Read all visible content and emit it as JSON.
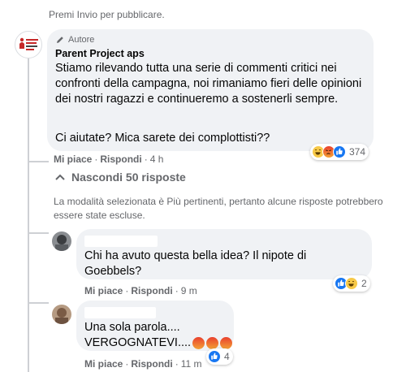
{
  "composer_hint": "Premi Invio per pubblicare.",
  "main_comment": {
    "avatar_text": "Parent Project",
    "author_badge": "Autore",
    "author_name": "Parent Project aps",
    "paragraph1": "Stiamo rilevando tutta una serie di commenti critici nei confronti della campagna, noi rimaniamo fieri delle opinioni dei nostri ragazzi e continueremo a sostenerli sempre.",
    "paragraph2": "Ci aiutate? Mica sarete dei complottisti??",
    "like_label": "Mi piace",
    "reply_label": "Rispondi",
    "time": "4 h",
    "reaction_count": "374",
    "reactions": [
      "haha-icon",
      "angry-icon",
      "like-icon"
    ]
  },
  "replies_toggle": {
    "label": "Nascondi 50 risposte"
  },
  "relevance_note": "La modalità selezionata è Più pertinenti, pertanto alcune risposte potrebbero essere state escluse.",
  "replies": [
    {
      "text": "Chi ha avuto questa bella idea? Il nipote di Goebbels?",
      "like_label": "Mi piace",
      "reply_label": "Rispondi",
      "time": "9 m",
      "reaction_count": "2",
      "reactions": [
        "like-icon",
        "haha-icon"
      ]
    },
    {
      "text_line1": "Una sola parola....",
      "text_line2": "VERGOGNATEVI....",
      "like_label": "Mi piace",
      "reply_label": "Rispondi",
      "time": "11 m",
      "reaction_count": "4",
      "reactions": [
        "like-icon"
      ]
    }
  ],
  "colors": {
    "bubble": "#f0f2f5",
    "muted_text": "#65676b",
    "like_blue": "#1877f2",
    "angry_red": "#e9402e",
    "haha_yellow": "#f7c948"
  }
}
